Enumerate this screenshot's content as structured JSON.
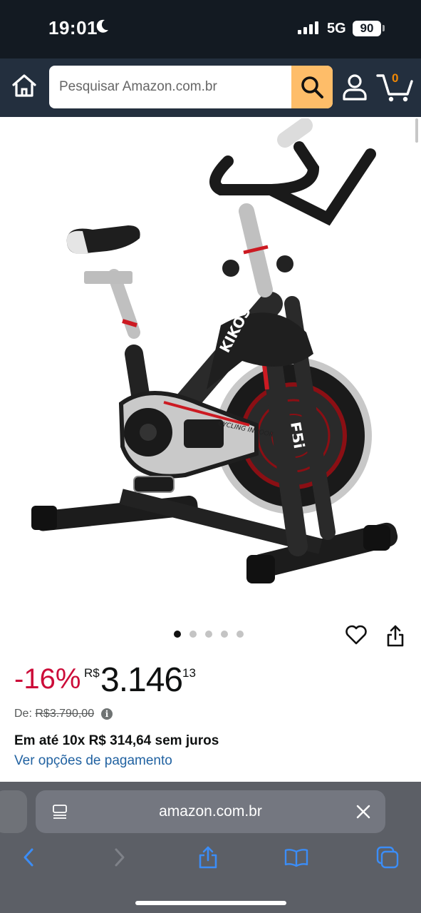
{
  "status_bar": {
    "time": "19:01",
    "network": "5G",
    "battery": "90"
  },
  "header": {
    "search_placeholder": "Pesquisar Amazon.com.br",
    "cart_count": "0",
    "colors": {
      "bar": "#232f3e",
      "search_button": "#febd69",
      "cart_count": "#f08804"
    }
  },
  "product": {
    "image_alt": "Bicicleta ergométrica spinning KIKOS F5i Cycling Indoor",
    "image_brand_text": "KIKOS",
    "image_model_text": "F5i",
    "image_frame_text": "CYCLING INDOOR",
    "gallery": {
      "count": 5,
      "active_index": 0
    },
    "discount": "-16%",
    "price_currency": "R$",
    "price_whole": "3.146",
    "price_cents": "13",
    "list_price_label": "De:",
    "list_price": "R$3.790,00",
    "installments": "Em até 10x R$ 314,64 sem juros",
    "payment_options_link": "Ver opções de pagamento",
    "colors": {
      "discount": "#cc0c39",
      "link": "#2162a1"
    }
  },
  "browser": {
    "url": "amazon.com.br",
    "toolbar": [
      "back-icon",
      "forward-icon",
      "share-icon",
      "bookmarks-icon",
      "tabs-icon"
    ]
  }
}
